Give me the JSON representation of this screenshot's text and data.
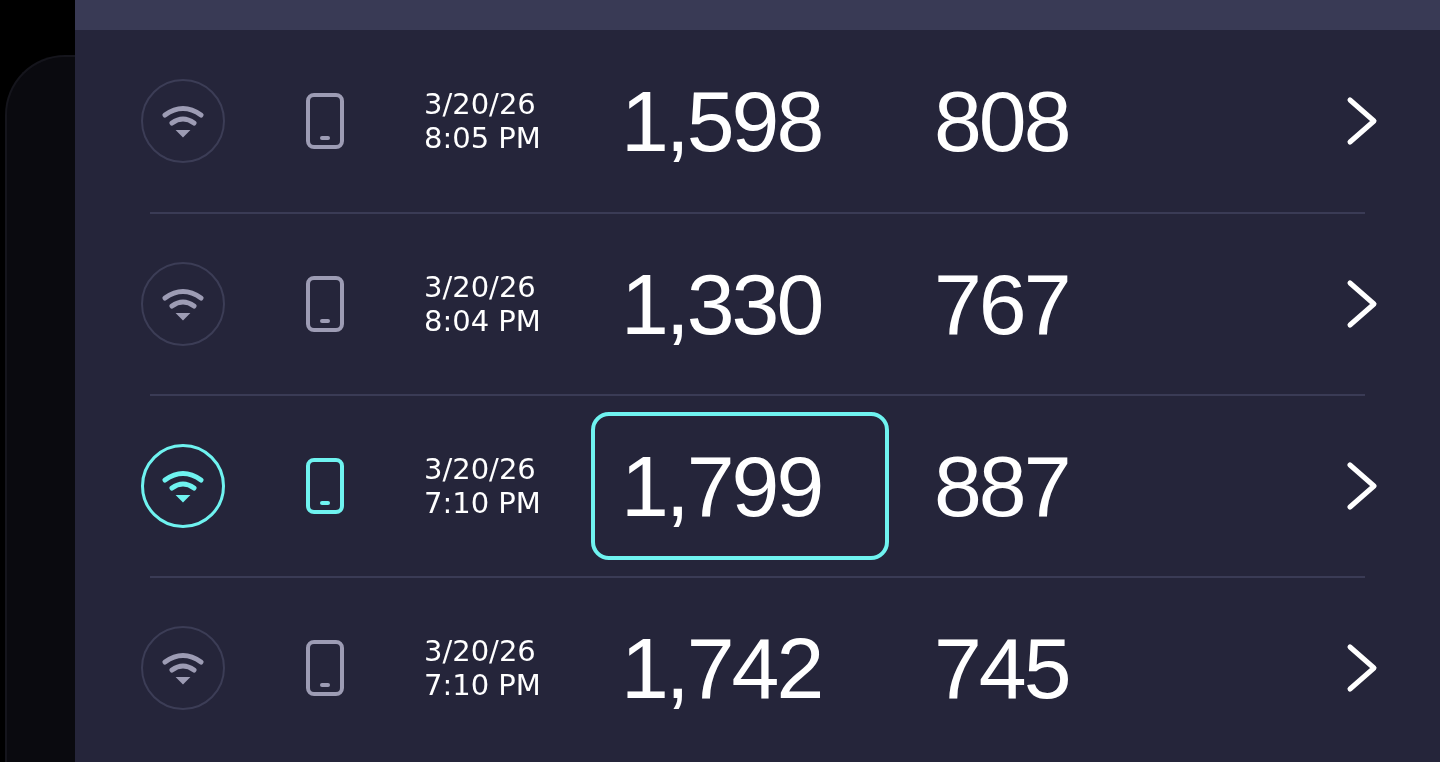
{
  "rows": [
    {
      "date": "3/20/26",
      "time": "8:05 PM",
      "value_1": "1,598",
      "value_2": "808",
      "selected": false
    },
    {
      "date": "3/20/26",
      "time": "8:04 PM",
      "value_1": "1,330",
      "value_2": "767",
      "selected": false
    },
    {
      "date": "3/20/26",
      "time": "7:10 PM",
      "value_1": "1,799",
      "value_2": "887",
      "selected": true
    },
    {
      "date": "3/20/26",
      "time": "7:10 PM",
      "value_1": "1,742",
      "value_2": "745",
      "selected": false
    }
  ]
}
